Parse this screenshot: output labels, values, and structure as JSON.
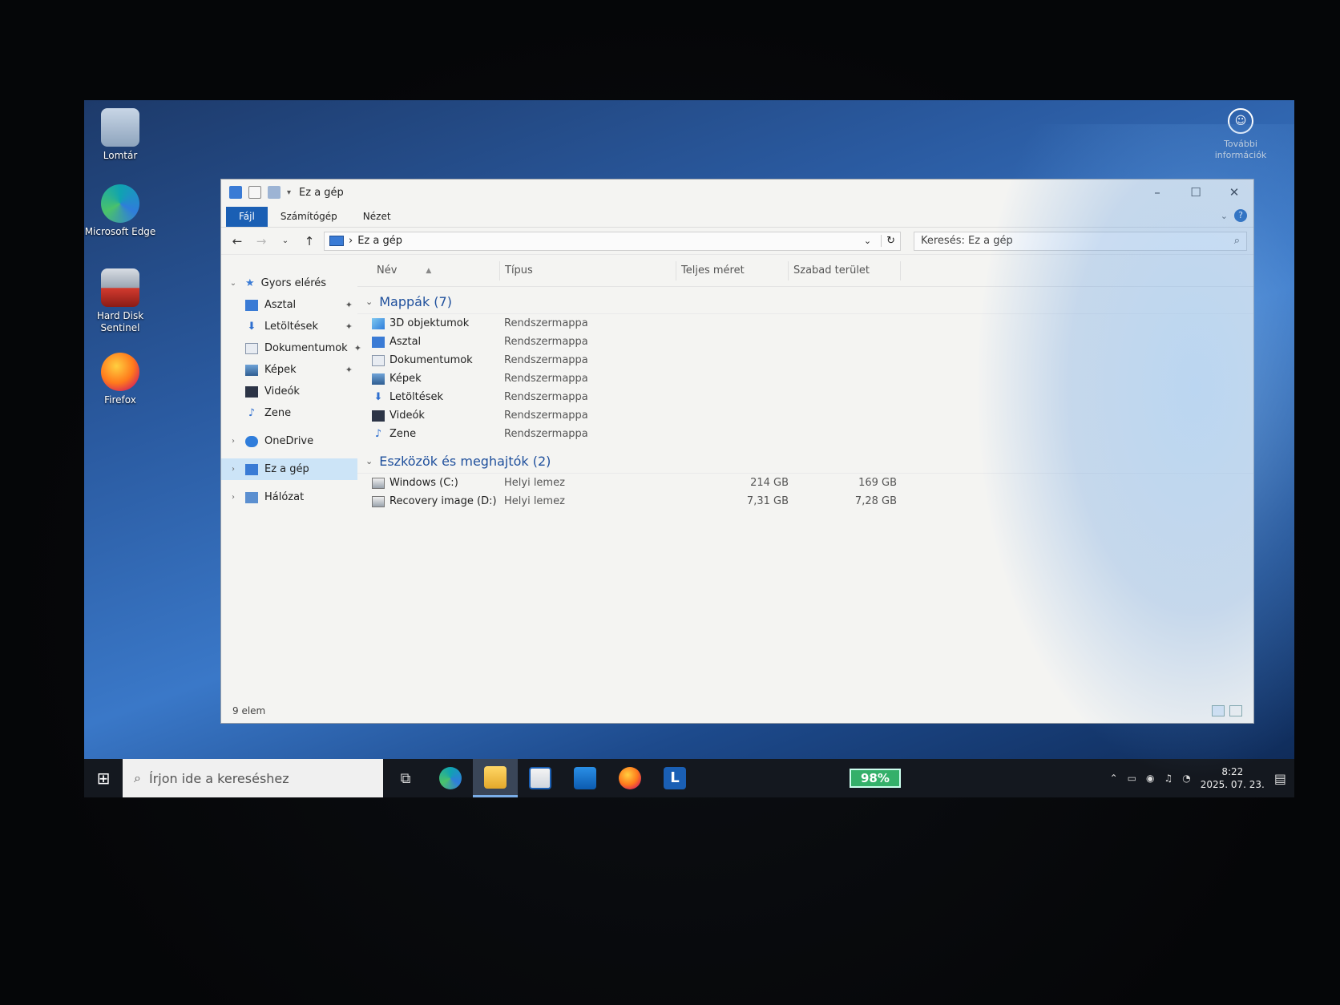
{
  "desktop": {
    "icons": [
      {
        "label": "Lomtár"
      },
      {
        "label": "Microsoft Edge"
      },
      {
        "label": "Hard Disk Sentinel"
      },
      {
        "label": "Firefox"
      }
    ],
    "corner_label": "További információk"
  },
  "window": {
    "title": "Ez a gép",
    "controls": {
      "minimize": "–",
      "maximize": "☐",
      "close": "✕"
    },
    "ribbon_tabs": [
      "Fájl",
      "Számítógép",
      "Nézet"
    ],
    "help": "?",
    "address": {
      "path": "Ez a gép",
      "separator": "›"
    },
    "search_placeholder": "Keresés: Ez a gép",
    "columns": {
      "name": "Név",
      "type": "Típus",
      "total": "Teljes méret",
      "free": "Szabad terület"
    },
    "nav": {
      "quick_access": "Gyors elérés",
      "quick_items": [
        "Asztal",
        "Letöltések",
        "Dokumentumok",
        "Képek",
        "Videók",
        "Zene"
      ],
      "onedrive": "OneDrive",
      "this_pc": "Ez a gép",
      "network": "Hálózat"
    },
    "groups": {
      "folders_title": "Mappák (7)",
      "folders": [
        {
          "name": "3D objektumok",
          "type": "Rendszermappa"
        },
        {
          "name": "Asztal",
          "type": "Rendszermappa"
        },
        {
          "name": "Dokumentumok",
          "type": "Rendszermappa"
        },
        {
          "name": "Képek",
          "type": "Rendszermappa"
        },
        {
          "name": "Letöltések",
          "type": "Rendszermappa"
        },
        {
          "name": "Videók",
          "type": "Rendszermappa"
        },
        {
          "name": "Zene",
          "type": "Rendszermappa"
        }
      ],
      "drives_title": "Eszközök és meghajtók (2)",
      "drives": [
        {
          "name": "Windows (C:)",
          "type": "Helyi lemez",
          "total": "214 GB",
          "free": "169 GB"
        },
        {
          "name": "Recovery image (D:)",
          "type": "Helyi lemez",
          "total": "7,31 GB",
          "free": "7,28 GB"
        }
      ]
    },
    "status": "9 elem"
  },
  "taskbar": {
    "search_placeholder": "Írjon ide a kereséshez",
    "battery": "98%",
    "time": "8:22",
    "date": "2025. 07. 23."
  },
  "colors": {
    "accent": "#1a5fb4",
    "selection": "#cce4f7",
    "group_header": "#1e4f9c"
  }
}
